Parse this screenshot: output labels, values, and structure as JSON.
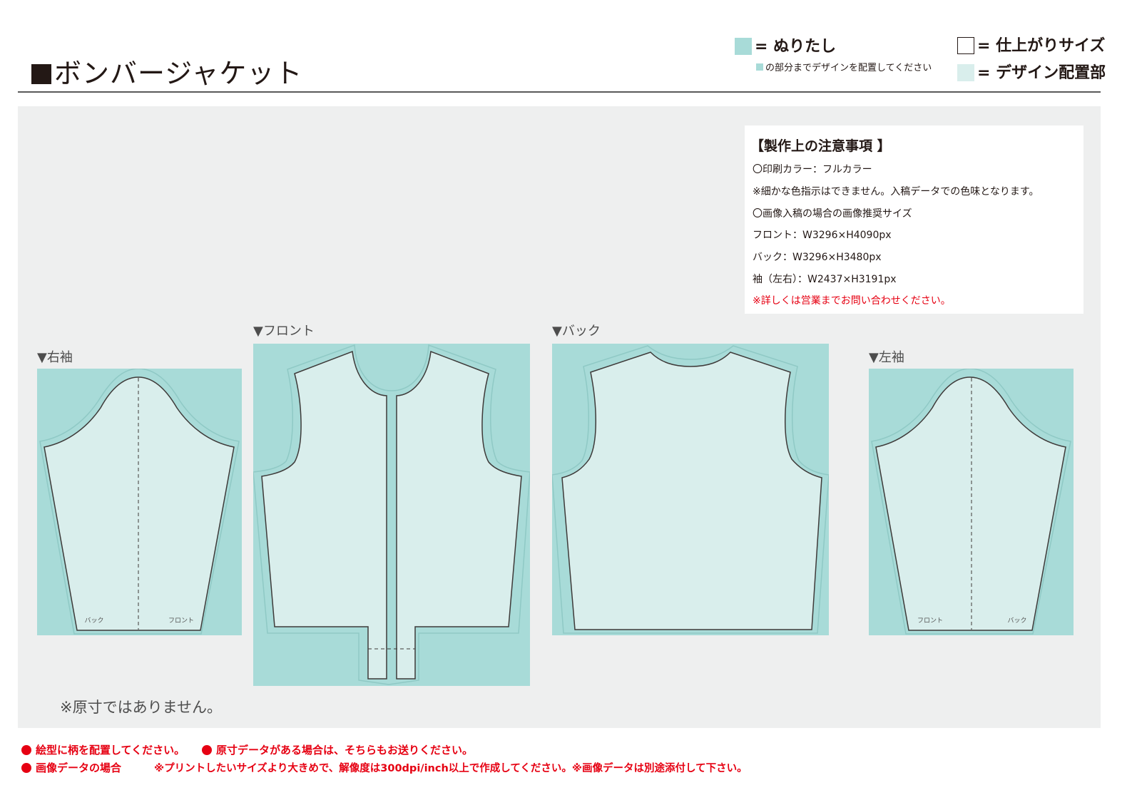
{
  "title": "ボンバージャケット",
  "legend": {
    "bleed_label": "= ぬりたし",
    "bleed_note": "の部分までデザインを配置してください",
    "finish_label": "= 仕上がりサイズ",
    "design_label": "= デザイン配置部"
  },
  "notes": {
    "heading": "【製作上の注意事項 】",
    "lines": [
      "〇印刷カラー：フルカラー",
      "※細かな色指示はできません。入稿データでの色味となります。",
      "〇画像入稿の場合の画像推奨サイズ",
      "フロント：W3296×H4090px",
      "バック：W3296×H3480px",
      "袖（左右）：W2437×H3191px",
      "※詳しくは営業までお問い合わせください。"
    ]
  },
  "panels": {
    "right_sleeve": "▼右袖",
    "front": "▼フロント",
    "back": "▼バック",
    "left_sleeve": "▼左袖"
  },
  "sleeve_marks": {
    "back": "バック",
    "front": "フロント"
  },
  "disclaimer": "※原寸ではありません。",
  "footer": {
    "item1": "絵型に柄を配置してください。",
    "item2": "原寸データがある場合は、そちらもお送りください。",
    "item3": "画像データの場合",
    "item3_detail": "※プリントしたいサイズより大きめで、解像度は300dpi/inch以上で作成してください。※画像データは別途添付して下さい。"
  },
  "colors": {
    "bleed": "#a8dbd8",
    "design_area": "#d9eeec",
    "panel_bg": "#eeefef",
    "note_red": "#e60012",
    "outline": "#3e3a39"
  }
}
